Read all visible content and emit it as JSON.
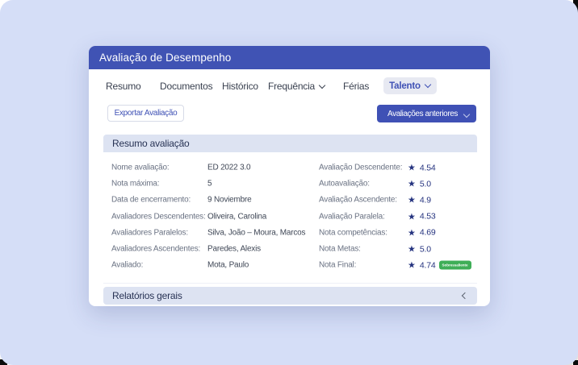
{
  "page": {
    "title": "Avaliação de Desempenho"
  },
  "tabs": [
    {
      "label": "Resumo",
      "chevron": false,
      "active": false
    },
    {
      "label": "Documentos",
      "chevron": false,
      "active": false
    },
    {
      "label": "Histórico",
      "chevron": false,
      "active": false
    },
    {
      "label": "Frequência",
      "chevron": true,
      "active": false
    },
    {
      "label": "Férias",
      "chevron": false,
      "active": false
    },
    {
      "label": "Talento",
      "chevron": true,
      "active": true
    }
  ],
  "toolbar": {
    "export_label": "Exportar Avaliação",
    "previous_label": "Avaliações anteriores"
  },
  "resumo": {
    "title": "Resumo avaliação",
    "left": [
      {
        "label": "Nome avaliação:",
        "value": "ED 2022 3.0"
      },
      {
        "label": "Nota máxima:",
        "value": "5"
      },
      {
        "label": "Data de encerramento:",
        "value": "9 Noviembre"
      },
      {
        "label": "Avaliadores Descendentes:",
        "value": "Oliveira, Carolina"
      },
      {
        "label": "Avaliadores Paralelos:",
        "value": "Silva, João – Moura, Marcos"
      },
      {
        "label": "Avaliadores Ascendentes:",
        "value": "Paredes, Alexis"
      },
      {
        "label": "Avaliado:",
        "value": "Mota, Paulo"
      }
    ],
    "right": [
      {
        "label": "Avaliação Descendente:",
        "value": "4.54"
      },
      {
        "label": "Autoavaliação:",
        "value": "5.0"
      },
      {
        "label": "Avaliação Ascendente:",
        "value": "4.9"
      },
      {
        "label": "Avaliação Paralela:",
        "value": "4.53"
      },
      {
        "label": "Nota competências:",
        "value": "4.69"
      },
      {
        "label": "Nota Metas:",
        "value": "5.0"
      },
      {
        "label": "Nota Final:",
        "value": "4.74",
        "badge": "Sobressaliente"
      }
    ]
  },
  "relatorios": {
    "title": "Relatórios gerais"
  },
  "colors": {
    "background": "#d5def7",
    "header_blue": "#4053b4",
    "accent_blue": "#3f51b5",
    "section_bar": "#dde3f2",
    "badge_green": "#3fae57",
    "star_navy": "#25337f"
  }
}
